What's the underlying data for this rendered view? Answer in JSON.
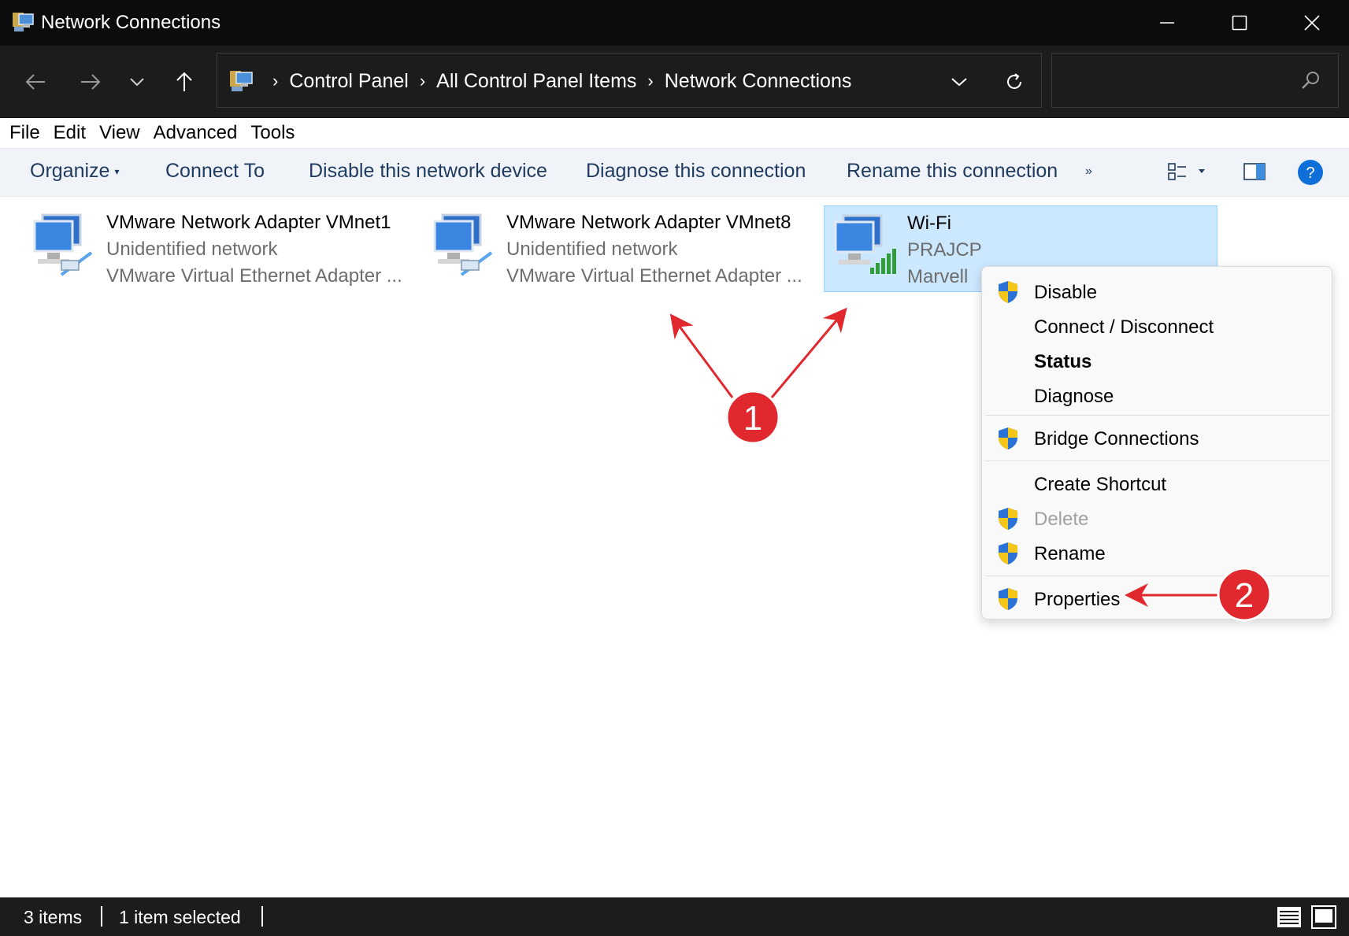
{
  "window": {
    "title": "Network Connections",
    "controls": [
      "minimize-icon",
      "maximize-icon",
      "close-icon"
    ]
  },
  "nav": {
    "breadcrumbs": [
      "Control Panel",
      "All Control Panel Items",
      "Network Connections"
    ],
    "search_value": ""
  },
  "menubar": {
    "items": [
      "File",
      "Edit",
      "View",
      "Advanced",
      "Tools"
    ]
  },
  "commandbar": {
    "organize": "Organize",
    "connect_to": "Connect To",
    "disable_device": "Disable this network device",
    "diagnose": "Diagnose this connection",
    "rename": "Rename this connection",
    "overflow": "»"
  },
  "connections": [
    {
      "name": "VMware Network Adapter VMnet1",
      "status": "Unidentified network",
      "device": "VMware Virtual Ethernet Adapter ...",
      "icon": "ethernet-adapter-icon",
      "selected": false
    },
    {
      "name": "VMware Network Adapter VMnet8",
      "status": "Unidentified network",
      "device": "VMware Virtual Ethernet Adapter ...",
      "icon": "ethernet-adapter-icon",
      "selected": false
    },
    {
      "name": "Wi-Fi",
      "status": "PRAJCP",
      "device": "Marvell",
      "icon": "wifi-adapter-icon",
      "selected": true
    }
  ],
  "context_menu": {
    "disable": "Disable",
    "connect_disconnect": "Connect / Disconnect",
    "status": "Status",
    "diagnose": "Diagnose",
    "bridge": "Bridge Connections",
    "create_shortcut": "Create Shortcut",
    "delete": "Delete",
    "rename": "Rename",
    "properties": "Properties"
  },
  "annotations": {
    "badge_1": "1",
    "badge_2": "2",
    "color": "#e0282e"
  },
  "statusbar": {
    "item_count": "3 items",
    "selected": "1 item selected"
  },
  "colors": {
    "titlebar": "#0c0c0c",
    "navbar": "#1c1c1c",
    "commandbar": "#f0f4f9",
    "selection": "#cce8ff",
    "help_blue": "#0f6fd8"
  }
}
